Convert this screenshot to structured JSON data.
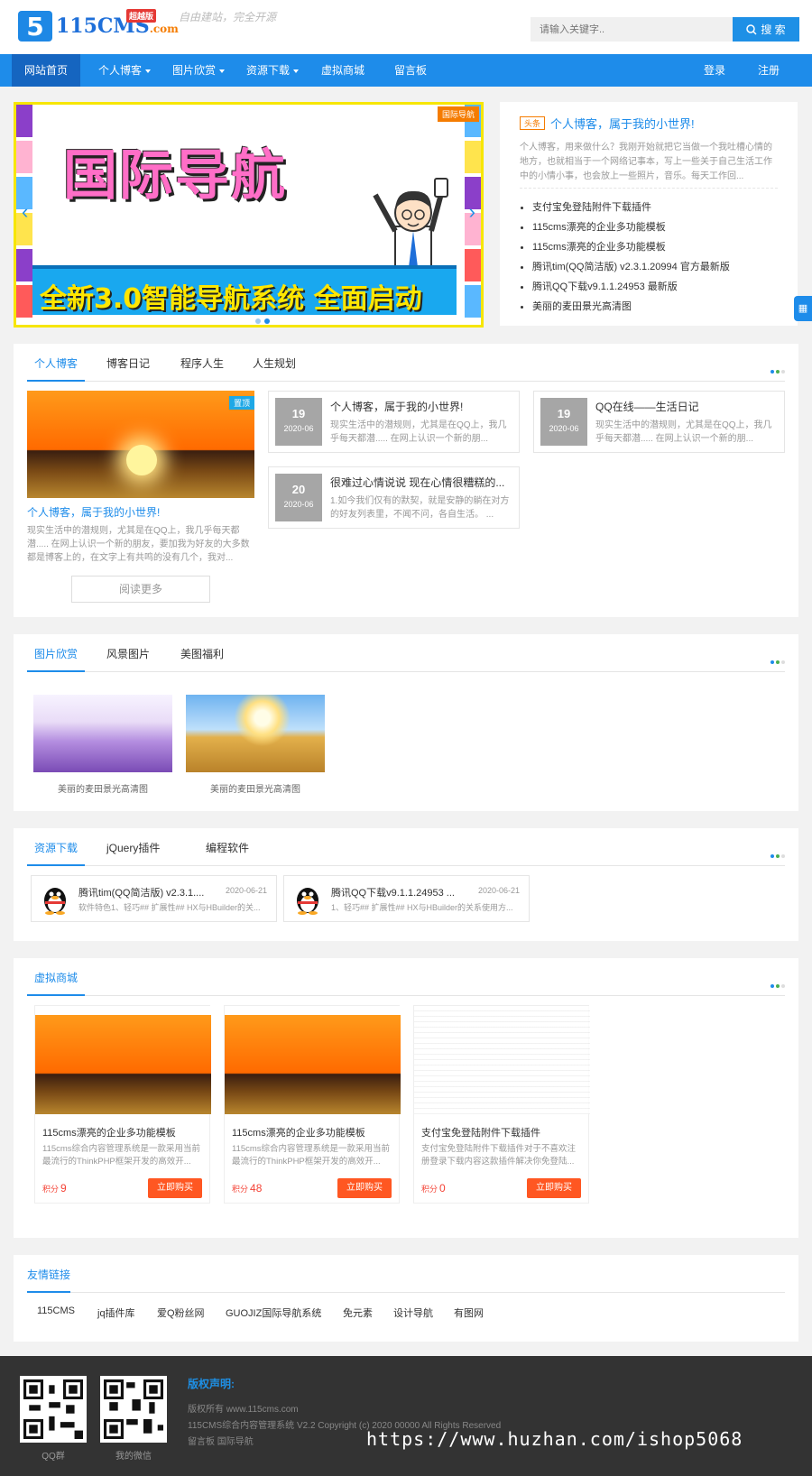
{
  "header": {
    "logo_number": "5",
    "logo_text": "115CMS",
    "logo_domain": ".com",
    "logo_badge": "超越版",
    "slogan": "自由建站，完全开源",
    "search_placeholder": "请输入关键字..",
    "search_button": "搜 索"
  },
  "nav": {
    "items": [
      {
        "label": "网站首页",
        "active": true
      },
      {
        "label": "个人博客",
        "dropdown": true
      },
      {
        "label": "图片欣赏",
        "dropdown": true
      },
      {
        "label": "资源下载",
        "dropdown": true
      },
      {
        "label": "虚拟商城"
      },
      {
        "label": "留言板"
      }
    ],
    "login": "登录",
    "register": "注册"
  },
  "banner": {
    "tag": "国际导航",
    "title": "国际导航",
    "subtitle": "全新3.0智能导航系统 全面启动"
  },
  "headline": {
    "tag": "头条",
    "title": "个人博客，属于我的小世界!",
    "desc": "个人博客，用来做什么？我刚开始就把它当做一个我吐槽心情的地方，也就相当于一个网络记事本，写上一些关于自己生活工作中的小情小事，也会放上一些照片，音乐。每天工作回...",
    "list": [
      "支付宝免登陆附件下载插件",
      "115cms漂亮的企业多功能模板",
      "115cms漂亮的企业多功能模板",
      "腾讯tim(QQ简洁版) v2.3.1.20994 官方最新版",
      "腾讯QQ下载v9.1.1.24953 最新版",
      "美丽的麦田景光高清图"
    ]
  },
  "blog": {
    "tabs": [
      "个人博客",
      "博客日记",
      "程序人生",
      "人生规划"
    ],
    "feature": {
      "tag": "置顶",
      "title": "个人博客，属于我的小世界!",
      "desc": "现实生活中的潜规则，尤其是在QQ上，我几乎每天都潜..... 在网上认识一个新的朋友，要加我为好友的大多数都是博客上的，在文字上有共鸣的没有几个，我对...",
      "more": "阅读更多"
    },
    "posts": [
      {
        "day": "19",
        "month": "2020-06",
        "title": "个人博客，属于我的小世界!",
        "desc": "现实生活中的潜规则，尤其是在QQ上，我几乎每天都潜..... 在网上认识一个新的朋..."
      },
      {
        "day": "19",
        "month": "2020-06",
        "title": "QQ在线——生活日记",
        "desc": "现实生活中的潜规则，尤其是在QQ上，我几乎每天都潜..... 在网上认识一个新的朋..."
      },
      {
        "day": "20",
        "month": "2020-06",
        "title": "很难过心情说说 现在心情很糟糕的...",
        "desc": "1.如今我们仅有的默契，就是安静的躺在对方的好友列表里，不闻不问，各自生活。 ..."
      }
    ]
  },
  "pictures": {
    "tabs": [
      "图片欣赏",
      "风景图片",
      "美图福利"
    ],
    "items": [
      {
        "caption": "美丽的麦田景光高清图"
      },
      {
        "caption": "美丽的麦田景光高清图"
      }
    ]
  },
  "downloads": {
    "tabs": [
      "资源下载",
      "jQuery插件",
      "编程软件"
    ],
    "items": [
      {
        "title": "腾讯tim(QQ简洁版) v2.3.1....",
        "date": "2020-06-21",
        "desc": "软件特色1、轻巧## 扩展性## HX与HBuilder的关..."
      },
      {
        "title": "腾讯QQ下载v9.1.1.24953 ...",
        "date": "2020-06-21",
        "desc": "1、轻巧## 扩展性## HX与HBuilder的关系使用方..."
      }
    ]
  },
  "shop": {
    "tabs": [
      "虚拟商城"
    ],
    "points_label": "积分",
    "buy_label": "立即购买",
    "items": [
      {
        "title": "115cms漂亮的企业多功能模板",
        "desc": "115cms综合内容管理系统是一款采用当前最流行的ThinkPHP框架开发的高效开...",
        "points": "9"
      },
      {
        "title": "115cms漂亮的企业多功能模板",
        "desc": "115cms综合内容管理系统是一款采用当前最流行的ThinkPHP框架开发的高效开...",
        "points": "48"
      },
      {
        "title": "支付宝免登陆附件下载插件",
        "desc": "支付宝免登陆附件下载插件对于不喜欢注册登录下载内容这款插件解决你免登陆...",
        "points": "0"
      }
    ]
  },
  "links": {
    "title": "友情链接",
    "items": [
      "115CMS",
      "jq插件库",
      "爱Q粉丝网",
      "GUOJIZ国际导航系统",
      "免元素",
      "设计导航",
      "有图网"
    ]
  },
  "footer": {
    "qr1": "QQ群",
    "qr2": "我的微信",
    "title": "版权声明:",
    "line1": "版权所有 www.115cms.com",
    "line2": "115CMS综合内容管理系统 V2.2   Copyright (c) 2020   00000 All Rights Reserved",
    "line3": "留言板  国际导航"
  },
  "watermark": "https://www.huzhan.com/ishop5068",
  "colors": {
    "primary": "#1e8cea",
    "accent": "#ff5722",
    "footer": "#333333"
  }
}
